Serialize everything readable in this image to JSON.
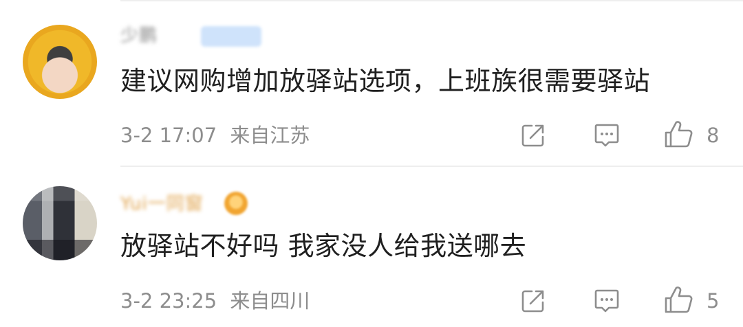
{
  "comments": [
    {
      "username": "少鹏",
      "text": "建议网购增加放驿站选项，上班族很需要驿站",
      "time": "3-2 17:07",
      "location": "来自江苏",
      "likes": "8",
      "icons": [
        "share-icon",
        "comment-icon",
        "like-icon"
      ]
    },
    {
      "username": "Yui一同窗",
      "text": "放驿站不好吗 我家没人给我送哪去",
      "time": "3-2 23:25",
      "location": "来自四川",
      "likes": "5",
      "icons": [
        "share-icon",
        "comment-icon",
        "like-icon"
      ]
    }
  ]
}
